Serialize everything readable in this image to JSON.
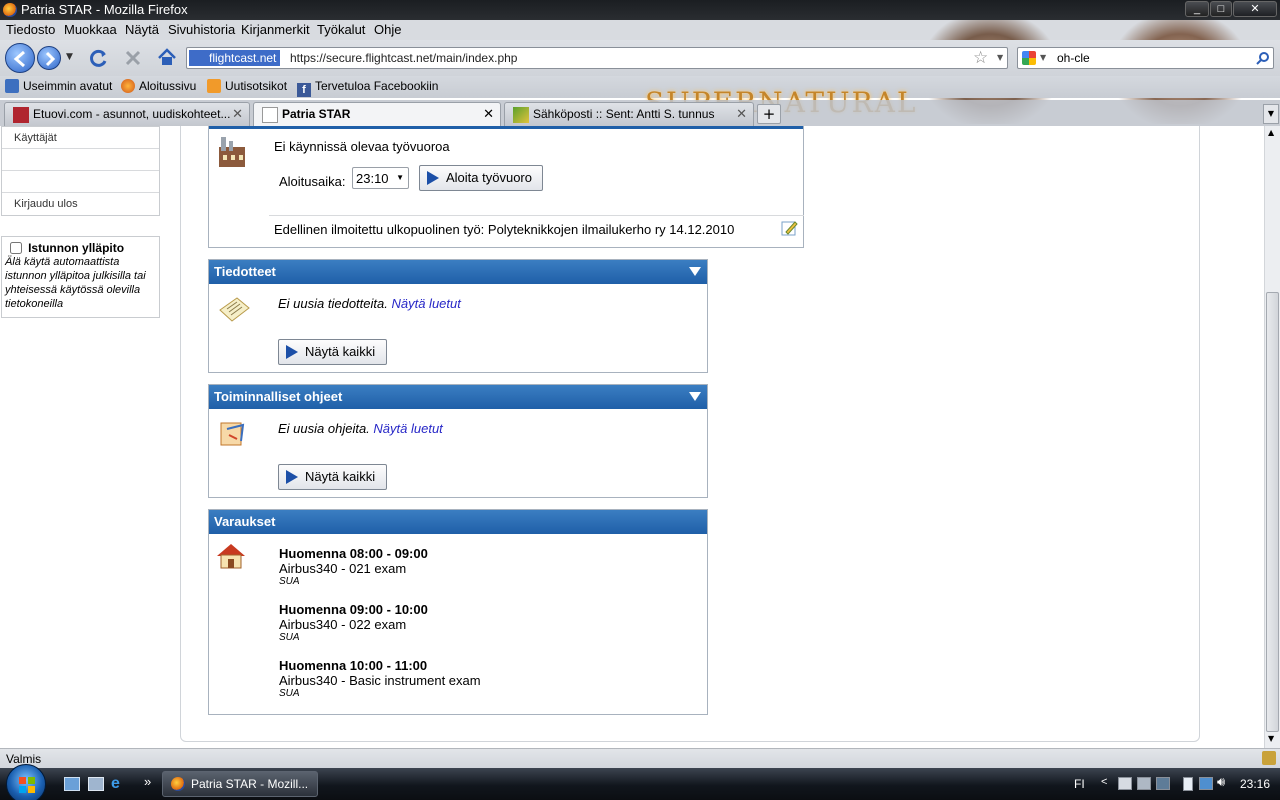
{
  "window": {
    "title": "Patria STAR - Mozilla Firefox",
    "controls": [
      "_",
      "□",
      "✕"
    ]
  },
  "menu": [
    "Tiedosto",
    "Muokkaa",
    "Näytä",
    "Sivuhistoria",
    "Kirjanmerkit",
    "Työkalut",
    "Ohje"
  ],
  "nav": {
    "identity": "flightcast.net",
    "url": "https://secure.flightcast.net/main/index.php",
    "search_value": "oh-cle"
  },
  "bookmarks": [
    "Useimmin avatut",
    "Aloitussivu",
    "Uutisotsikot",
    "Tervetuloa Facebookiin"
  ],
  "persona_title": "SUPERNATURAL",
  "tabs": [
    {
      "label": "Etuovi.com - asunnot, uudiskohteet...",
      "active": false
    },
    {
      "label": "Patria STAR",
      "active": true
    },
    {
      "label": "Sähköposti :: Sent: Antti S. tunnus",
      "active": false
    }
  ],
  "sidebar": {
    "items": [
      "Käyttäjät",
      "",
      "",
      "Kirjaudu ulos"
    ],
    "session_label": "Istunnon ylläpito",
    "session_note": "Älä käytä automaattista istunnon ylläpitoa julkisilla tai yhteisessä käytössä olevilla tietokoneilla",
    "session_checked": false
  },
  "shift": {
    "status": "Ei käynnissä olevaa työvuoroa",
    "start_label": "Aloitusaika:",
    "start_time": "23:10",
    "start_button": "Aloita työvuoro",
    "previous": "Edellinen ilmoitettu ulkopuolinen työ: Polyteknikkojen ilmailukerho ry 14.12.2010"
  },
  "tiedotteet": {
    "title": "Tiedotteet",
    "message": "Ei uusia tiedotteita.",
    "link": "Näytä luetut",
    "button": "Näytä kaikki"
  },
  "ohjeet": {
    "title": "Toiminnalliset ohjeet",
    "message": "Ei uusia ohjeita.",
    "link": "Näytä luetut",
    "button": "Näytä kaikki"
  },
  "varaukset": {
    "title": "Varaukset",
    "items": [
      {
        "time": "Huomenna 08:00 - 09:00",
        "name": "Airbus340 - 021 exam",
        "tag": "SUA"
      },
      {
        "time": "Huomenna 09:00 - 10:00",
        "name": "Airbus340 - 022 exam",
        "tag": "SUA"
      },
      {
        "time": "Huomenna 10:00 - 11:00",
        "name": "Airbus340 - Basic instrument exam",
        "tag": "SUA"
      }
    ]
  },
  "status_text": "Valmis",
  "taskbar": {
    "window_label": "Patria STAR - Mozill...",
    "lang": "FI",
    "clock": "23:16"
  },
  "colors": {
    "box_header": "#2a6cb6",
    "link": "#2727c7"
  }
}
